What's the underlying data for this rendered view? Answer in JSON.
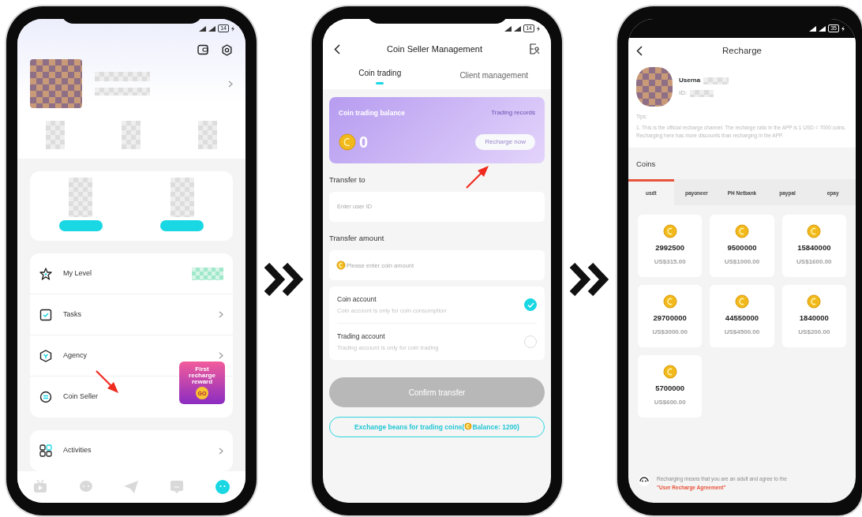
{
  "profile_screen": {
    "battery": "14",
    "menu": [
      {
        "label": "My Level",
        "chevron": false
      },
      {
        "label": "Tasks",
        "chevron": true
      },
      {
        "label": "Agency",
        "chevron": true
      },
      {
        "label": "Coin Seller",
        "chevron": false
      }
    ],
    "promo_badge": {
      "title": "First recharge reward",
      "button": "GO"
    },
    "activities": {
      "label": "Activities",
      "chevron": true
    },
    "bottom_nav": [
      {
        "selected": false
      },
      {
        "selected": false
      },
      {
        "selected": false
      },
      {
        "selected": false
      },
      {
        "selected": true
      }
    ]
  },
  "coin_seller_screen": {
    "battery": "14",
    "title": "Coin Seller Management",
    "tabs": [
      {
        "label": "Coin trading",
        "selected": true
      },
      {
        "label": "Client management",
        "selected": false
      }
    ],
    "balance_card": {
      "label": "Coin trading balance",
      "records_link": "Trading records",
      "amount": "0",
      "recharge_button": "Recharge now"
    },
    "transfer_to": {
      "label": "Transfer to",
      "placeholder": "Enter user ID"
    },
    "transfer_amount": {
      "label": "Transfer amount",
      "placeholder": "Please enter coin amount"
    },
    "accounts": [
      {
        "title": "Coin account",
        "description": "Coin account is only for coin consumption",
        "selected": true
      },
      {
        "title": "Trading account",
        "description": "Trading account is only for coin trading",
        "selected": false
      }
    ],
    "confirm_button": {
      "label": "Confirm transfer",
      "disabled": true
    },
    "exchange_button": {
      "text_before": "Exchange beans for trading coins(",
      "text_after": "Balance: 1200)"
    }
  },
  "recharge_screen": {
    "battery": "35",
    "title": "Recharge",
    "username_label": "Userna",
    "id_label": "ID:",
    "tips_label": "Tips:",
    "tips_text": "1. This is the official recharge channel. The recharge ratio in the APP is 1 USD = 7000 coins. Recharging here has more discounts than recharging in the APP.",
    "coins_heading": "Coins",
    "payment_methods": [
      {
        "label": "usdt",
        "selected": true
      },
      {
        "label": "payoneer",
        "selected": false
      },
      {
        "label": "PH Netbank",
        "selected": false
      },
      {
        "label": "paypal",
        "selected": false
      },
      {
        "label": "epay",
        "selected": false
      }
    ],
    "packages": [
      {
        "coins": "2992500",
        "price": "US$315.00"
      },
      {
        "coins": "9500000",
        "price": "US$1000.00"
      },
      {
        "coins": "15840000",
        "price": "US$1600.00"
      },
      {
        "coins": "29700000",
        "price": "US$3000.00"
      },
      {
        "coins": "44550000",
        "price": "US$4500.00"
      },
      {
        "coins": "1840000",
        "price": "US$200.00"
      },
      {
        "coins": "5700000",
        "price": "US$600.00"
      }
    ],
    "footer_text": "Recharging means that you are an adult and agree to the ",
    "footer_link": "\"User Recharge Agreement\""
  }
}
